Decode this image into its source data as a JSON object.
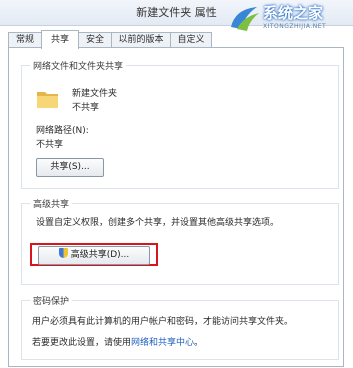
{
  "window": {
    "title": "新建文件夹 属性"
  },
  "watermark": {
    "main": "系统之家",
    "sub": "XITONGZHIJIA.NET"
  },
  "tabs": [
    {
      "label": "常规"
    },
    {
      "label": "共享"
    },
    {
      "label": "安全"
    },
    {
      "label": "以前的版本"
    },
    {
      "label": "自定义"
    }
  ],
  "network_sharing": {
    "group_title": "网络文件和文件夹共享",
    "folder_name": "新建文件夹",
    "share_status": "不共享",
    "path_label": "网络路径(N):",
    "path_value": "不共享",
    "share_button": "共享(S)..."
  },
  "advanced_sharing": {
    "group_title": "高级共享",
    "description": "设置自定义权限，创建多个共享，并设置其他高级共享选项。",
    "button": "高级共享(D)..."
  },
  "password_protection": {
    "group_title": "密码保护",
    "description": "用户必须具有此计算机的用户帐户和密码，才能访问共享文件夹。",
    "change_text": "若要更改此设置，请使用",
    "link": "网络和共享中心",
    "suffix": "。"
  },
  "colors": {
    "highlight": "#d6161c",
    "link": "#1f5fbf"
  }
}
